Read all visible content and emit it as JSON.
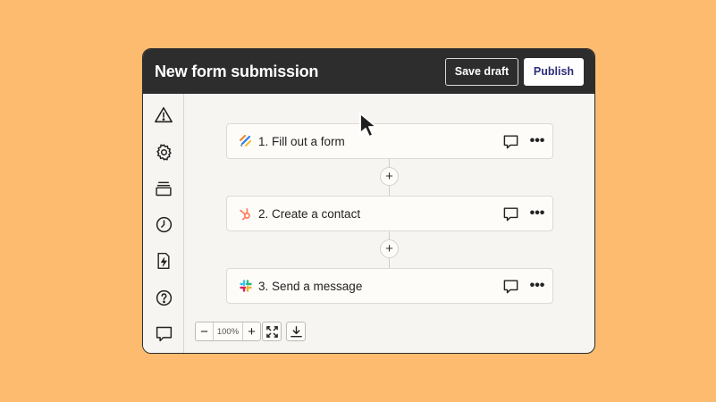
{
  "header": {
    "title": "New form submission",
    "save_draft_label": "Save draft",
    "publish_label": "Publish"
  },
  "sidebar": {
    "items": [
      {
        "name": "warning-icon"
      },
      {
        "name": "gear-icon"
      },
      {
        "name": "versions-icon"
      },
      {
        "name": "clock-icon"
      },
      {
        "name": "file-bolt-icon"
      },
      {
        "name": "help-icon"
      },
      {
        "name": "comment-icon"
      }
    ]
  },
  "steps": [
    {
      "label": "1. Fill out a form",
      "icon": "form-app-icon"
    },
    {
      "label": "2. Create a contact",
      "icon": "hubspot-icon"
    },
    {
      "label": "3. Send a message",
      "icon": "slack-icon"
    }
  ],
  "zoom": {
    "level": "100%",
    "minus": "−",
    "plus": "+"
  },
  "colors": {
    "background": "#fdbb6f",
    "header": "#2d2d2d",
    "publish_text": "#2d2f7a",
    "hubspot": "#ff7a59"
  }
}
